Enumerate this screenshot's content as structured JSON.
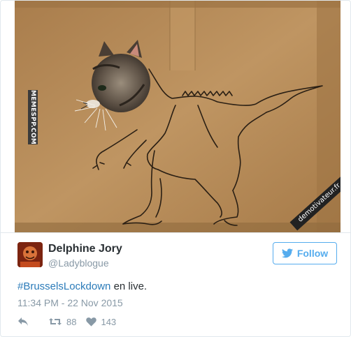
{
  "media": {
    "watermark_left": "MEMESPP.COM",
    "watermark_right": "demotivateur.fr"
  },
  "author": {
    "name": "Delphine Jory",
    "handle": "@Ladyblogue"
  },
  "follow_button": {
    "label": "Follow",
    "icon": "twitter-bird-icon"
  },
  "tweet": {
    "hashtag": "#BrusselsLockdown",
    "text": " en live."
  },
  "timestamp": "11:34 PM - 22 Nov 2015",
  "actions": {
    "reply_icon": "reply-icon",
    "retweet_icon": "retweet-icon",
    "retweet_count": "88",
    "like_icon": "heart-icon",
    "like_count": "143"
  },
  "colors": {
    "accent": "#55acee",
    "hashtag": "#2b7bb9",
    "muted": "#8899a6",
    "text": "#292f33",
    "cardboard": "#b58a57"
  }
}
